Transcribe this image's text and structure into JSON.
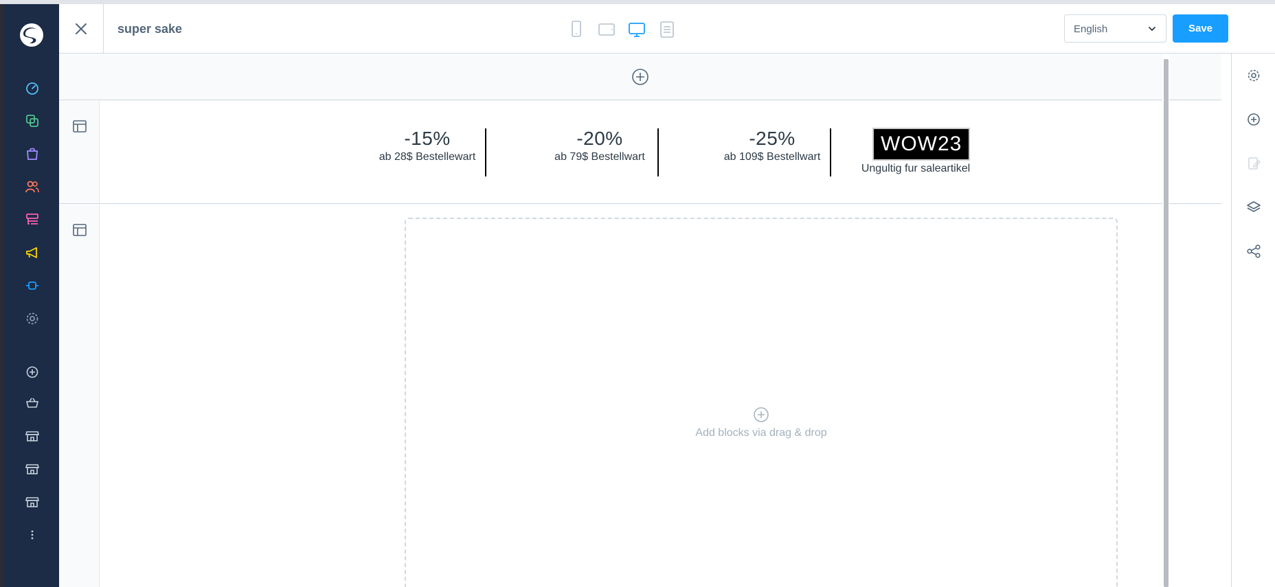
{
  "header": {
    "title": "super sake",
    "language": "English",
    "save_label": "Save"
  },
  "devices": [
    "mobile-icon",
    "tablet-icon",
    "desktop-icon",
    "form-icon"
  ],
  "promo": {
    "items": [
      {
        "percent": "-15%",
        "condition": "ab 28$ Bestellewart"
      },
      {
        "percent": "-20%",
        "condition": "ab 79$ Bestellwart"
      },
      {
        "percent": "-25%",
        "condition": "ab 109$ Bestellwart"
      }
    ],
    "code": "WOW23",
    "code_note": "Ungultig fur saleartikel"
  },
  "dropzone": {
    "text": "Add blocks via drag & drop"
  },
  "colors": {
    "sidebar": "#1c2b46",
    "accent": "#189eff",
    "border": "#d1d9e0",
    "text": "#52667a"
  },
  "sidebar_icons": [
    "dashboard-icon",
    "catalog-icon",
    "orders-icon",
    "customers-icon",
    "content-icon",
    "marketing-icon",
    "extensions-icon",
    "settings-icon",
    "add-icon",
    "basket-icon",
    "storefront-icon",
    "storefront-icon",
    "storefront-icon",
    "more-icon"
  ],
  "right_icons": [
    "settings-icon",
    "add-block-icon",
    "edit-icon",
    "layers-icon",
    "share-icon"
  ]
}
